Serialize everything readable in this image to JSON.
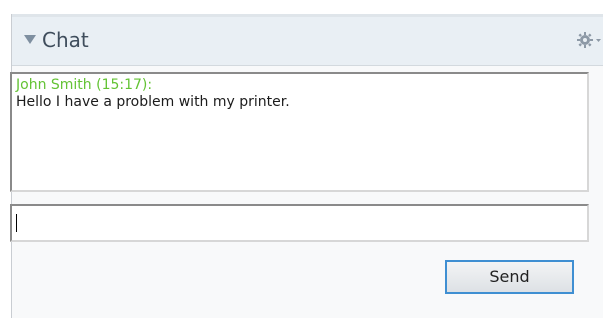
{
  "chat": {
    "title": "Chat",
    "messages": [
      {
        "author_line": "John Smith (15:17):",
        "text": "Hello I have a problem with my printer."
      }
    ],
    "input": {
      "value": "",
      "placeholder": ""
    },
    "send_label": "Send"
  },
  "icons": {
    "collapse": "triangle-down-icon",
    "settings": "gear-icon"
  },
  "colors": {
    "author": "#63c334",
    "send_border": "#3f8fd2",
    "header_bg": "#e9eff4"
  }
}
